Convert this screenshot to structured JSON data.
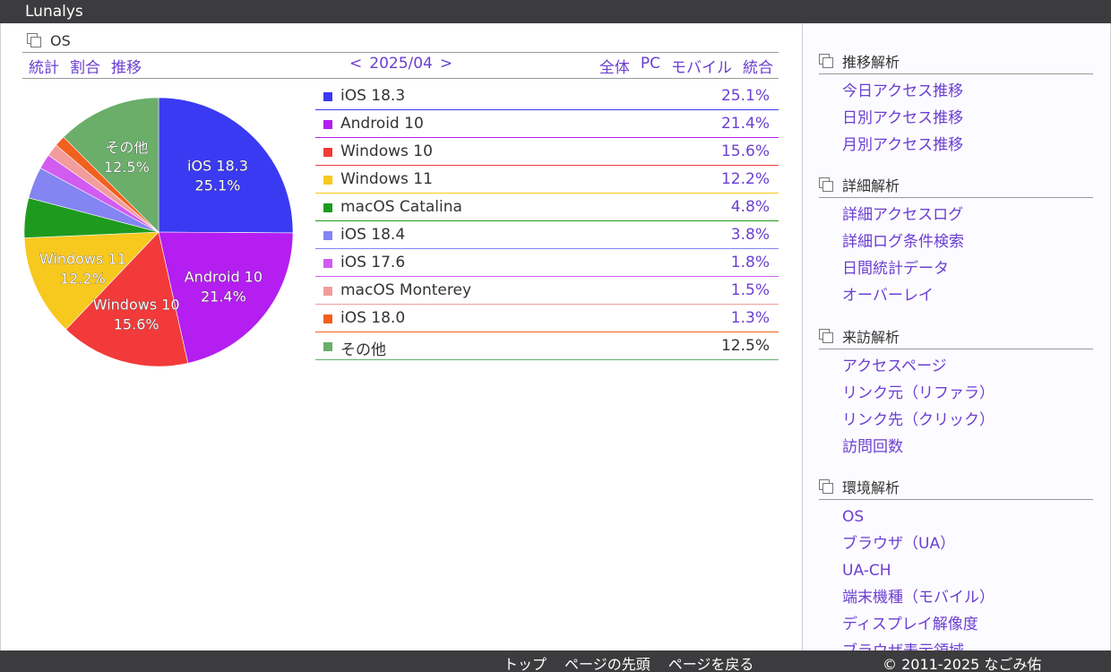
{
  "app": {
    "title": "Lunalys"
  },
  "page": {
    "title": "OS"
  },
  "nav": {
    "views": [
      "統計",
      "割合",
      "推移"
    ],
    "prev": "<",
    "period": "2025/04",
    "next": ">",
    "filters": [
      "全体",
      "PC",
      "モバイル",
      "統合"
    ]
  },
  "chart_data": {
    "type": "pie",
    "title": "",
    "slices": [
      {
        "name": "iOS 18.3",
        "value": 25.1,
        "label": "25.1%",
        "color": "#3a3af2"
      },
      {
        "name": "Android 10",
        "value": 21.4,
        "label": "21.4%",
        "color": "#b41ef0"
      },
      {
        "name": "Windows 10",
        "value": 15.6,
        "label": "15.6%",
        "color": "#f23a3a"
      },
      {
        "name": "Windows 11",
        "value": 12.2,
        "label": "12.2%",
        "color": "#f7c81e"
      },
      {
        "name": "macOS Catalina",
        "value": 4.8,
        "label": "4.8%",
        "color": "#1e9b1e"
      },
      {
        "name": "iOS 18.4",
        "value": 3.8,
        "label": "3.8%",
        "color": "#8484f2"
      },
      {
        "name": "iOS 17.6",
        "value": 1.8,
        "label": "1.8%",
        "color": "#d25cf2"
      },
      {
        "name": "macOS Monterey",
        "value": 1.5,
        "label": "1.5%",
        "color": "#f29c9c"
      },
      {
        "name": "iOS 18.0",
        "value": 1.3,
        "label": "1.3%",
        "color": "#f2601e"
      },
      {
        "name": "その他",
        "value": 12.5,
        "label": "12.5%",
        "color": "#6aae6a"
      }
    ],
    "pie_labels": [
      "iOS 18.3",
      "Android 10",
      "Windows 10",
      "Windows 11",
      "その他"
    ]
  },
  "sidebar": {
    "sections": [
      {
        "title": "推移解析",
        "items": [
          "今日アクセス推移",
          "日別アクセス推移",
          "月別アクセス推移"
        ]
      },
      {
        "title": "詳細解析",
        "items": [
          "詳細アクセスログ",
          "詳細ログ条件検索",
          "日間統計データ",
          "オーバーレイ"
        ]
      },
      {
        "title": "来訪解析",
        "items": [
          "アクセスページ",
          "リンク元（リファラ）",
          "リンク先（クリック）",
          "訪問回数"
        ]
      },
      {
        "title": "環境解析",
        "items": [
          "OS",
          "ブラウザ（UA）",
          "UA-CH",
          "端末機種（モバイル）",
          "ディスプレイ解像度",
          "ブラウザ表示領域"
        ]
      }
    ]
  },
  "footer": {
    "links": [
      "トップ",
      "ページの先頭",
      "ページを戻る"
    ],
    "copyright": "© 2011-2025 なごみ佑"
  }
}
